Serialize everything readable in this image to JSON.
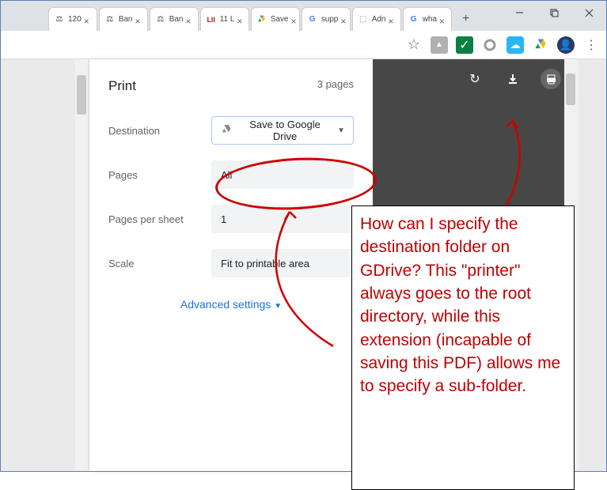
{
  "tabs": [
    {
      "icon": "scales",
      "label": "120"
    },
    {
      "icon": "scales",
      "label": "Ban"
    },
    {
      "icon": "scales",
      "label": "Ban"
    },
    {
      "icon": "lii",
      "label": "11 L"
    },
    {
      "icon": "drive",
      "label": "Save"
    },
    {
      "icon": "g",
      "label": "supp"
    },
    {
      "icon": "adm",
      "label": "Adn"
    },
    {
      "icon": "g",
      "label": "wha"
    }
  ],
  "extensions": {
    "star": "star-icon",
    "adobe": "adobe-icon",
    "check": "check-icon",
    "ring": "ring-icon",
    "cloud": "cloud-icon",
    "drive": "drive-icon",
    "avatar": "avatar-icon",
    "menu": "menu-icon"
  },
  "print": {
    "title": "Print",
    "page_count": "3 pages",
    "rows": {
      "destination": {
        "label": "Destination",
        "value": "Save to Google Drive"
      },
      "pages": {
        "label": "Pages",
        "value": "All"
      },
      "pps": {
        "label": "Pages per sheet",
        "value": "1"
      },
      "scale": {
        "label": "Scale",
        "value": "Fit to printable area"
      }
    },
    "advanced": "Advanced settings"
  },
  "annotation": {
    "text": "How can I specify the destination folder on GDrive? This \"printer\" always goes to the root directory, while this extension (incapable of saving this PDF) allows me to specify a sub-folder."
  },
  "colors": {
    "annotation": "#c00000",
    "link": "#1a73e8"
  }
}
